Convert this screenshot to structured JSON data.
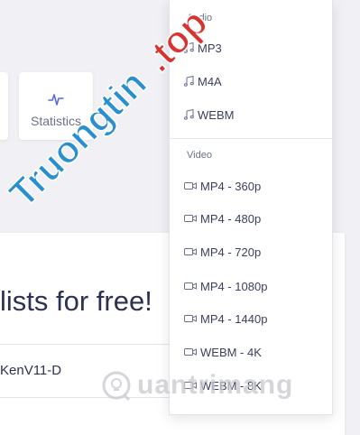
{
  "stats_card": {
    "label": "Statistics",
    "icon": "activity-icon"
  },
  "headline": "lists for free!",
  "playlist_id": "KenV11-D",
  "dropdown": {
    "audio_label": "Audio",
    "audio_options": [
      "MP3",
      "M4A",
      "WEBM"
    ],
    "video_label": "Video",
    "video_options": [
      "MP4 - 360p",
      "MP4 - 480p",
      "MP4 - 720p",
      "MP4 - 1080p",
      "MP4 - 1440p",
      "WEBM - 4K",
      "WEBM - 8K"
    ]
  },
  "watermarks": {
    "top": "Truongtin.top",
    "bottom": "uantrimang"
  },
  "colors": {
    "accent": "#5a6bd8",
    "watermark_blue": "#2a8fcf",
    "watermark_red": "#d8342f"
  }
}
